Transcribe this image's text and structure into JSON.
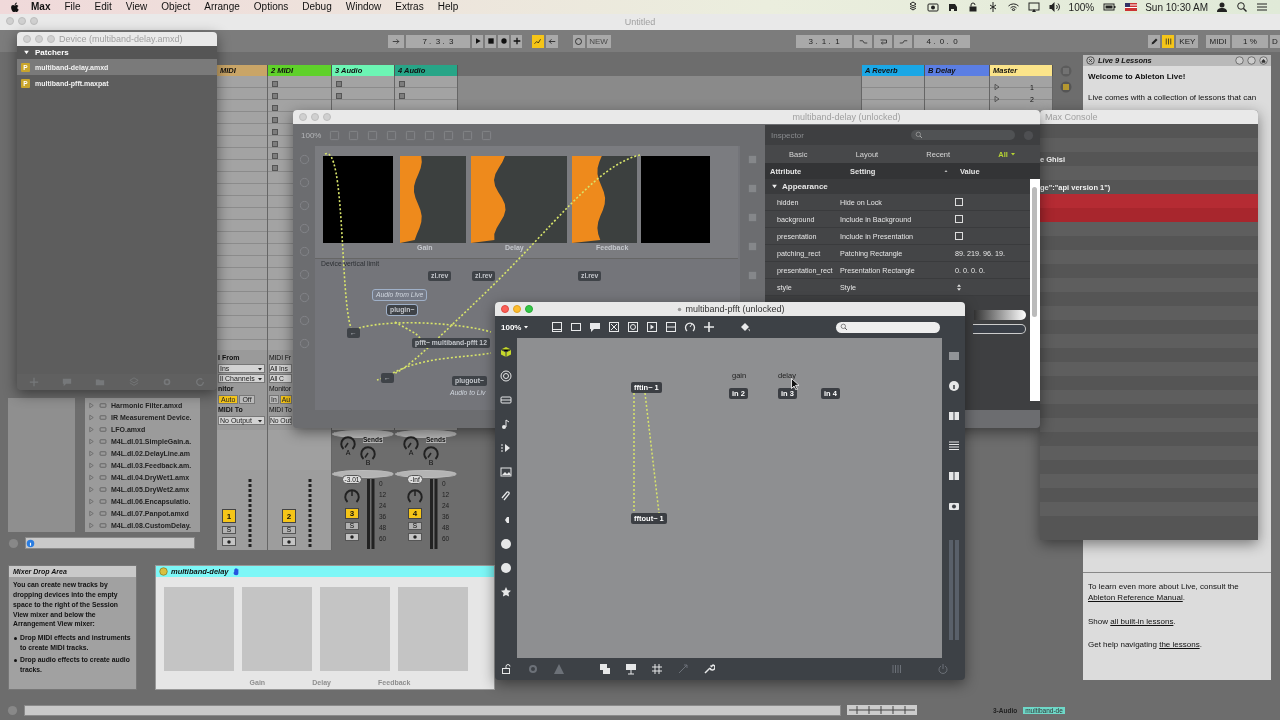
{
  "menu_bar": {
    "app": "Max",
    "menus": [
      "File",
      "Edit",
      "View",
      "Object",
      "Arrange",
      "Options",
      "Debug",
      "Window",
      "Extras",
      "Help"
    ],
    "battery": "100%",
    "clock": "Sun 10:30 AM"
  },
  "live": {
    "title": "Untitled",
    "focused": false,
    "transport": {
      "position": "7 .  3 .  3",
      "new_button": "NEW",
      "loop_start": "3 .  1 .  1",
      "loop_length": "4 .  0 .  0",
      "key_button": "KEY",
      "midi_button": "MIDI",
      "cpu": "1 %",
      "disk": "D"
    },
    "tracks": [
      {
        "name": "MIDI",
        "color": "#c9a567"
      },
      {
        "name": "2 MIDI",
        "color": "#5fd12a"
      },
      {
        "name": "3 Audio",
        "color": "#6cf5b4"
      },
      {
        "name": "4 Audio",
        "color": "#27a587"
      }
    ],
    "returns": [
      {
        "name": "A Reverb",
        "color": "#1aa7e6"
      },
      {
        "name": "B Delay",
        "color": "#5b7ee3"
      },
      {
        "name": "Master",
        "color": "#fbe48a"
      }
    ],
    "master_slots": [
      "1",
      "2"
    ],
    "io": [
      {
        "from": "I From",
        "from_value": "Ins",
        "channel": "ll Channels",
        "monitor_label": "nitor",
        "monitor": [
          {
            "label": "Auto",
            "selected": true
          },
          {
            "label": "Off",
            "selected": false
          }
        ],
        "to": "MIDI To",
        "to_value": "No Output"
      },
      {
        "from": "MIDI Fr",
        "from_value": "All Ins",
        "channel": "All C",
        "monitor_label": "Monitor",
        "monitor": [
          {
            "label": "In",
            "selected": false
          },
          {
            "label": "Au",
            "selected": true
          }
        ],
        "to": "MIDI To",
        "to_value": "No Out"
      }
    ],
    "strips": [
      {
        "number": "1",
        "active": true,
        "solo": "S"
      },
      {
        "number": "2",
        "active": true,
        "solo": "S"
      },
      {
        "number": "3",
        "active": true,
        "solo": "S",
        "sends_label": "Sends",
        "sends": [
          "A",
          "B"
        ],
        "volume": "-3.01",
        "scale": [
          "0",
          "12",
          "24",
          "36",
          "48",
          "60"
        ]
      },
      {
        "number": "4",
        "active": true,
        "solo": "S",
        "sends_label": "Sends",
        "sends": [
          "A",
          "B"
        ],
        "volume": "-Inf",
        "scale": [
          "0",
          "12",
          "24",
          "36",
          "48",
          "60"
        ]
      }
    ],
    "browser": [
      "Harmonic Filter.amxd",
      "IR Measurement Device.",
      "LFO.amxd",
      "M4L.dl.01.SimpleGain.a.",
      "M4L.dl.02.DelayLine.am",
      "M4L.dl.03.Feedback.am.",
      "M4L.dl.04.DryWet1.amx",
      "M4L.dl.05.DryWet2.amx",
      "M4L.dl.06.Encapsulatio.",
      "M4L.dl.07.Panpot.amxd",
      "M4L.dl.08.CustomDelay."
    ],
    "drop_area": {
      "title": "Mixer Drop Area",
      "text": "You can create new tracks by dropping devices into the empty space to the right of the Session View mixer and below the Arrangement View mixer:",
      "bullets": [
        "Drop MIDI effects and instruments to create MIDI tracks.",
        "Drop audio effects to create audio tracks."
      ]
    },
    "device": {
      "title": "multiband-delay",
      "labels": [
        "Gain",
        "Delay",
        "Feedback"
      ]
    },
    "lessons": {
      "title": "Live 9 Lessons",
      "heading": "Welcome to Ableton Live!",
      "intro": "Live comes with a collection of lessons that can",
      "paragraphs": [
        {
          "before": "To learn even more about Live, consult the",
          "link": "Ableton Reference Manual",
          "after": "."
        },
        {
          "before": "Show",
          "link": "all built-in lessons",
          "after": "."
        },
        {
          "before": "Get help navigating",
          "link": "the lessons",
          "after": "."
        }
      ]
    },
    "status_bar": {
      "track": "3-Audio",
      "device": "multiband-de"
    }
  },
  "device_window": {
    "title": "Device (multiband-delay.amxd)",
    "focused": false,
    "section": "Patchers",
    "items": [
      {
        "badge": "P",
        "name": "multiband-delay.amxd",
        "selected": true
      },
      {
        "badge": "P",
        "name": "multiband-pfft.maxpat",
        "selected": false
      }
    ]
  },
  "max_console": {
    "title": "Max Console",
    "focused": false,
    "lines": [
      {
        "kind": "message"
      },
      {
        "kind": "message"
      },
      {
        "kind": "message",
        "text": "e Ghisi"
      },
      {
        "kind": "message"
      },
      {
        "kind": "message",
        "text": "ge\":\"api version 1\")"
      },
      {
        "kind": "error"
      },
      {
        "kind": "error"
      }
    ]
  },
  "delay_patcher": {
    "title": "multiband-delay (unlocked)",
    "focused": false,
    "zoom": "100%",
    "sliders": [
      {
        "kind": "panel"
      },
      {
        "kind": "multislider"
      },
      {
        "kind": "multislider"
      },
      {
        "kind": "multislider"
      },
      {
        "kind": "panel"
      }
    ],
    "slider_labels": [
      "Gain",
      "Delay",
      "Feedback"
    ],
    "objects": [
      {
        "kind": "comment",
        "text": "Device vertical limit",
        "selected": false
      },
      {
        "kind": "object",
        "text": "zl.rev",
        "selected": false
      },
      {
        "kind": "object",
        "text": "zl.rev",
        "selected": false
      },
      {
        "kind": "object",
        "text": "zl.rev",
        "selected": false
      },
      {
        "kind": "comment",
        "text": "Audio from Live",
        "selected": true
      },
      {
        "kind": "object",
        "text": "plugin~",
        "selected": true
      },
      {
        "kind": "object",
        "text": "←",
        "selected": false
      },
      {
        "kind": "object",
        "text": "pfft~ multiband-pfft 12",
        "selected": false
      },
      {
        "kind": "object",
        "text": "←",
        "selected": false
      },
      {
        "kind": "object",
        "text": "plugout~",
        "selected": false
      },
      {
        "kind": "comment",
        "text": "Audio to Liv",
        "selected": false
      }
    ],
    "inspector": {
      "title": "Inspector",
      "tabs": [
        {
          "label": "Basic",
          "selected": false
        },
        {
          "label": "Layout",
          "selected": false
        },
        {
          "label": "Recent",
          "selected": false
        },
        {
          "label": "All",
          "selected": true
        }
      ],
      "columns": [
        "Attribute",
        "Setting",
        "Value"
      ],
      "section": "Appearance",
      "rows": [
        {
          "attribute": "hidden",
          "setting": "Hide on Lock",
          "kind": "checkbox",
          "checked": false
        },
        {
          "attribute": "background",
          "setting": "Include in Background",
          "kind": "checkbox",
          "checked": false
        },
        {
          "attribute": "presentation",
          "setting": "Include in Presentation",
          "kind": "checkbox",
          "checked": false
        },
        {
          "attribute": "patching_rect",
          "setting": "Patching Rectangle",
          "kind": "text",
          "value": "89. 219. 96. 19."
        },
        {
          "attribute": "presentation_rect",
          "setting": "Presentation Rectangle",
          "kind": "text",
          "value": "0. 0. 0. 0."
        },
        {
          "attribute": "style",
          "setting": "Style",
          "kind": "menu"
        }
      ]
    }
  },
  "pfft_patcher": {
    "title": "multiband-pfft (unlocked)",
    "focused": true,
    "zoom": "100%",
    "objects": [
      {
        "kind": "object",
        "text": "fftin~ 1"
      },
      {
        "kind": "object",
        "text": "fftout~ 1"
      },
      {
        "kind": "comment",
        "text": "gain"
      },
      {
        "kind": "object",
        "text": "in 2"
      },
      {
        "kind": "comment",
        "text": "delay"
      },
      {
        "kind": "object",
        "text": "in 3"
      },
      {
        "kind": "object",
        "text": "in 4"
      }
    ]
  }
}
